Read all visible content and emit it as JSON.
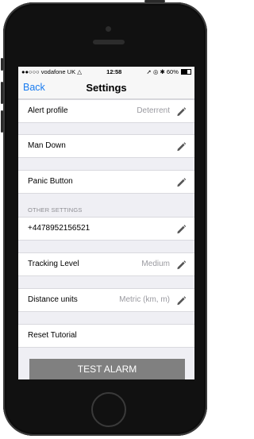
{
  "status_bar": {
    "carrier": "●●○○○ vodafone UK",
    "wifi_icon": "wifi-icon",
    "time": "12:58",
    "indicators": "➚ ◎ ✱",
    "battery_percent": "60%",
    "battery_level": 0.6
  },
  "navbar": {
    "back_label": "Back",
    "title": "Settings"
  },
  "rows": {
    "alert_profile": {
      "label": "Alert profile",
      "value": "Deterrent"
    },
    "man_down": {
      "label": "Man Down"
    },
    "panic_button": {
      "label": "Panic Button"
    },
    "phone_number": {
      "label": "+4478952156521"
    },
    "tracking_level": {
      "label": "Tracking Level",
      "value": "Medium"
    },
    "distance_units": {
      "label": "Distance units",
      "value": "Metric (km, m)"
    },
    "reset_tutorial": {
      "label": "Reset Tutorial"
    }
  },
  "sections": {
    "other_settings": "OTHER SETTINGS"
  },
  "test_alarm_label": "TEST ALARM",
  "colors": {
    "accent": "#1a7cf0",
    "alarm_button": "#808080",
    "background": "#efeff4"
  }
}
